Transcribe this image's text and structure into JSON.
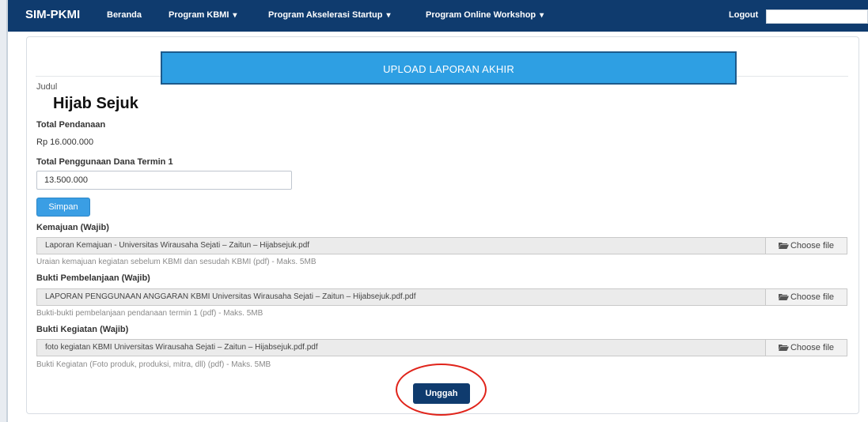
{
  "nav": {
    "brand": "SIM-PKMI",
    "items": [
      {
        "label": "Beranda",
        "caret": ""
      },
      {
        "label": "Program KBMI",
        "caret": "▾"
      },
      {
        "label": "Program Akselerasi Startup",
        "caret": "▾"
      },
      {
        "label": "Program Online Workshop",
        "caret": "▾"
      }
    ],
    "logout": "Logout"
  },
  "banner": {
    "text": "UPLOAD LAPORAN AKHIR"
  },
  "form": {
    "title_label": "Judul",
    "title_value": "Hijab Sejuk",
    "funding_label": "Total Pendanaan",
    "funding_value": "Rp 16.000.000",
    "usage_label": "Total Penggunaan Dana Termin 1",
    "usage_value": "13.500.000",
    "save_label": "Simpan"
  },
  "uploads": [
    {
      "label": "Kemajuan (Wajib)",
      "file": "Laporan Kemajuan - Universitas Wirausaha Sejati – Zaitun – Hijabsejuk.pdf",
      "button": "Choose file",
      "help": "Uraian kemajuan kegiatan sebelum KBMI dan sesudah KBMI (pdf) - Maks. 5MB"
    },
    {
      "label": "Bukti Pembelanjaan (Wajib)",
      "file": "LAPORAN  PENGGUNAAN ANGGARAN KBMI Universitas Wirausaha Sejati – Zaitun – Hijabsejuk.pdf.pdf",
      "button": "Choose file",
      "help": "Bukti-bukti pembelanjaan pendanaan termin 1 (pdf) - Maks. 5MB"
    },
    {
      "label": "Bukti Kegiatan (Wajib)",
      "file": "foto kegiatan KBMI Universitas Wirausaha Sejati – Zaitun – Hijabsejuk.pdf.pdf",
      "button": "Choose file",
      "help": "Bukti Kegiatan (Foto produk, produksi, mitra, dll) (pdf) - Maks. 5MB"
    }
  ],
  "submit_label": "Unggah",
  "colors": {
    "navbar": "#0f3b6e",
    "banner": "#2e9fe3",
    "save": "#3a9ee4",
    "annotation": "#e0241b"
  },
  "icons": {
    "file_button": "folder-open-icon",
    "dropdown": "caret-down-icon"
  }
}
